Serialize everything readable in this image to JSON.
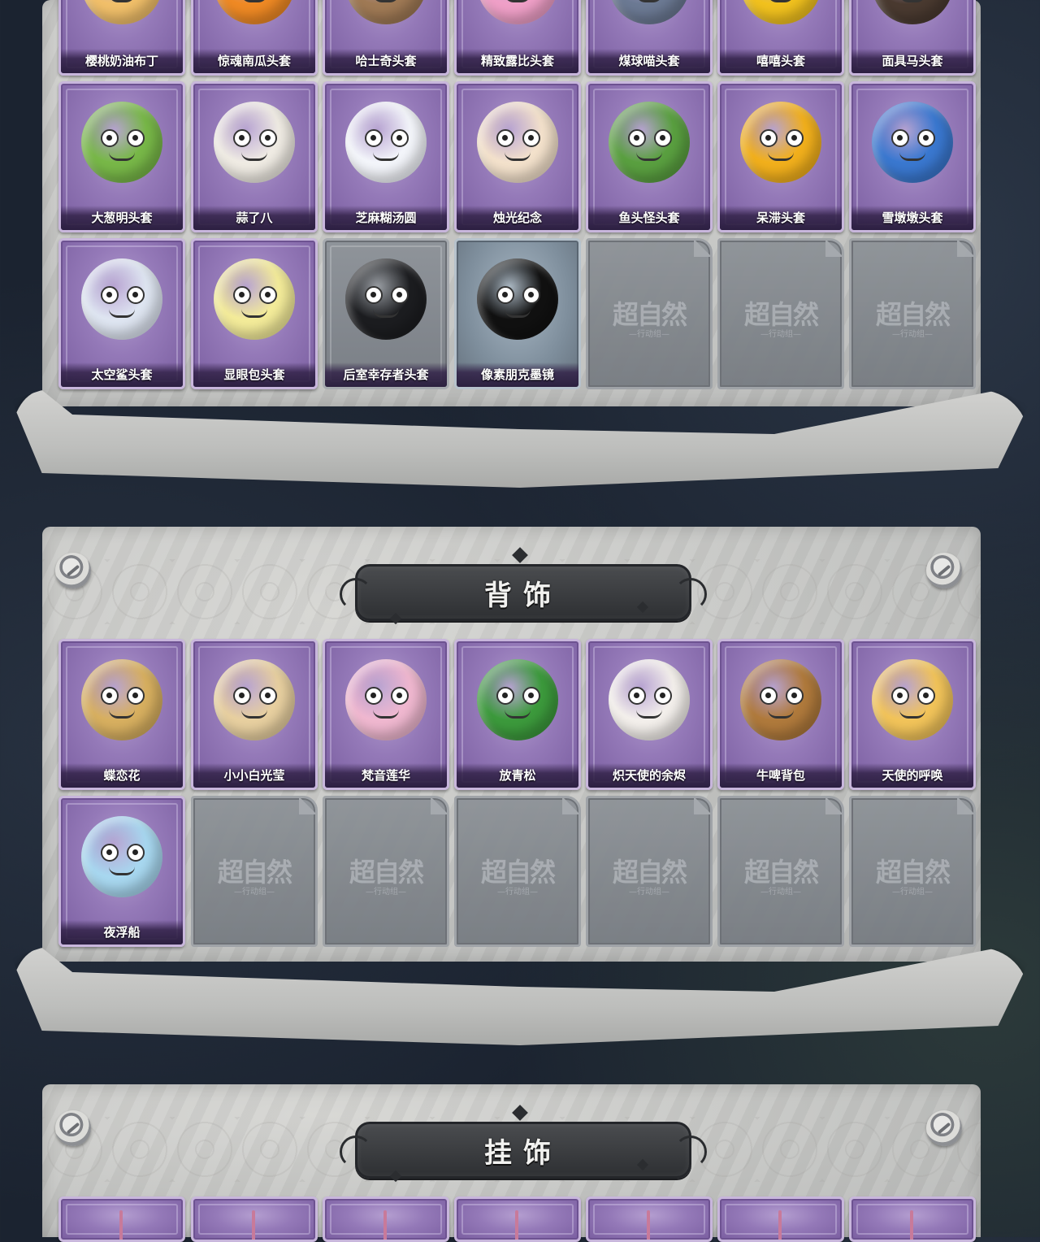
{
  "colors": {
    "panel_stone": "#c9cac8",
    "card_purple": "#9479b8",
    "card_locked_grey": "#7a7f86",
    "banner_dark": "#2e3033",
    "label_text": "#ffffff"
  },
  "row_top": [
    {
      "label": "樱桃奶油布丁",
      "icon": "pudding-head",
      "color": "#f2c06a"
    },
    {
      "label": "惊魂南瓜头套",
      "icon": "pumpkin-head",
      "color": "#f08a24"
    },
    {
      "label": "哈士奇头套",
      "icon": "husky-head",
      "color": "#a07a55"
    },
    {
      "label": "精致露比头套",
      "icon": "ruby-head",
      "color": "#f0a0c8"
    },
    {
      "label": "煤球喵头套",
      "icon": "cat-head",
      "color": "#6c7a94"
    },
    {
      "label": "嘻嘻头套",
      "icon": "grin-head",
      "color": "#f2c21e"
    },
    {
      "label": "面具马头套",
      "icon": "horse-mask-head",
      "color": "#4a3a30"
    }
  ],
  "row_mid": [
    {
      "label": "大葱明头套",
      "icon": "scallion-head",
      "color": "#78b848"
    },
    {
      "label": "蒜了八",
      "icon": "garlic-head",
      "color": "#f0ece4"
    },
    {
      "label": "芝麻糊汤圆",
      "icon": "dumpling-head",
      "color": "#f4f6fb"
    },
    {
      "label": "烛光纪念",
      "icon": "candle-head",
      "color": "#f4e2cc"
    },
    {
      "label": "鱼头怪头套",
      "icon": "fish-head",
      "color": "#5aa040"
    },
    {
      "label": "呆滞头套",
      "icon": "dazed-head",
      "color": "#f2b01c"
    },
    {
      "label": "雪墩墩头套",
      "icon": "snowman-head",
      "color": "#3a78d0"
    }
  ],
  "row_low": [
    {
      "label": "太空鲨头套",
      "icon": "shark-head",
      "color": "#dfe6f2",
      "tier": "purple"
    },
    {
      "label": "显眼包头套",
      "icon": "bulb-head",
      "color": "#f4ec9a",
      "tier": "purple"
    },
    {
      "label": "后室幸存者头套",
      "icon": "gasmask-head",
      "color": "#1c1d20",
      "tier": "grey"
    },
    {
      "label": "像素朋克墨镜",
      "icon": "pixel-glasses",
      "color": "#111111",
      "tier": "greyblue"
    }
  ],
  "placeholder": {
    "watermark": "超自然",
    "subtitle": "—行动组—"
  },
  "section_back": {
    "title": "背饰",
    "items": [
      {
        "label": "蝶恋花",
        "icon": "butterfly-bell",
        "color": "#d8b060"
      },
      {
        "label": "小小白光莹",
        "icon": "chibi-goddess",
        "color": "#e8d0a0"
      },
      {
        "label": "梵音莲华",
        "icon": "chibi-lotus",
        "color": "#f0b8d0"
      },
      {
        "label": "放青松",
        "icon": "pine-pot",
        "color": "#3c9a3c"
      },
      {
        "label": "炽天使的余烬",
        "icon": "chibi-angel",
        "color": "#f4f0ec"
      },
      {
        "label": "牛啤背包",
        "icon": "beer-cow",
        "color": "#b07a3c"
      },
      {
        "label": "天使的呼唤",
        "icon": "cherub",
        "color": "#f2c45a"
      },
      {
        "label": "夜浮船",
        "icon": "jellyfish",
        "color": "#a8d8f0"
      }
    ]
  },
  "section_hang": {
    "title": "挂饰"
  }
}
